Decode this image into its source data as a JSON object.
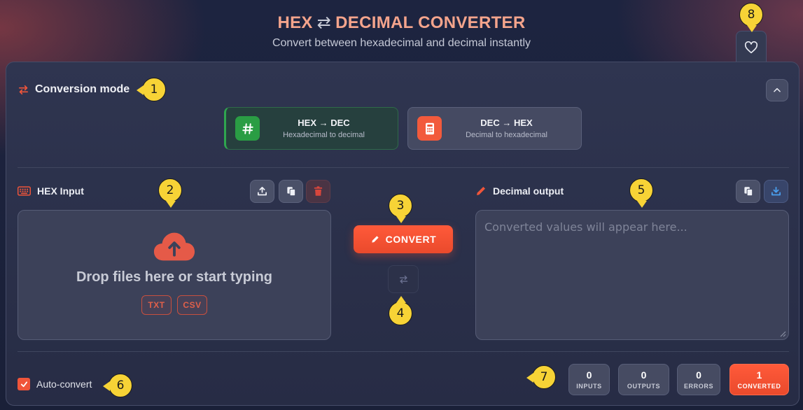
{
  "header": {
    "title_left": "HEX",
    "title_arrows": "⇄",
    "title_right": "DECIMAL CONVERTER",
    "subtitle": "Convert between hexadecimal and decimal instantly"
  },
  "mode": {
    "label": "Conversion mode",
    "options": [
      {
        "title": "HEX → DEC",
        "subtitle": "Hexadecimal to decimal",
        "icon": "hash-icon",
        "active": true
      },
      {
        "title": "DEC → HEX",
        "subtitle": "Decimal to hexadecimal",
        "icon": "calculator-icon",
        "active": false
      }
    ]
  },
  "input": {
    "label": "HEX Input",
    "dropzone_text": "Drop files here or start typing",
    "chips": [
      "TXT",
      "CSV"
    ]
  },
  "actions": {
    "convert_label": "CONVERT"
  },
  "output": {
    "label": "Decimal output",
    "placeholder": "Converted values will appear here..."
  },
  "footer": {
    "auto_convert_label": "Auto-convert",
    "auto_convert_checked": true,
    "stats": [
      {
        "value": "0",
        "label": "INPUTS"
      },
      {
        "value": "0",
        "label": "OUTPUTS"
      },
      {
        "value": "0",
        "label": "ERRORS"
      },
      {
        "value": "1",
        "label": "CONVERTED"
      }
    ]
  },
  "markers": [
    "1",
    "2",
    "3",
    "4",
    "5",
    "6",
    "7",
    "8"
  ],
  "colors": {
    "accent": "#f0553a",
    "title": "#f4a48c",
    "active_mode": "#2a9d44",
    "marker": "#f7d336"
  }
}
